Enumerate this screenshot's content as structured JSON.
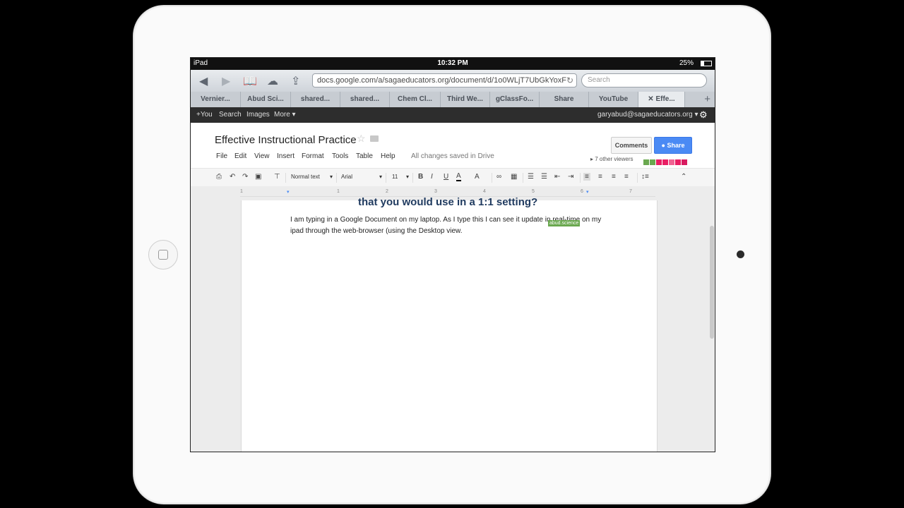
{
  "status": {
    "device": "iPad",
    "time": "10:32 PM",
    "battery": "25%"
  },
  "browser": {
    "url": "docs.google.com/a/sagaeducators.org/document/d/1o0WLjT7UbGkYoxF",
    "search_placeholder": "Search"
  },
  "tabs": [
    "Vernier...",
    "Abud Sci...",
    "shared...",
    "shared...",
    "Chem Cl...",
    "Third We...",
    "gClassFo...",
    "Share",
    "YouTube",
    "Effe..."
  ],
  "gbar": {
    "you": "+You",
    "search": "Search",
    "images": "Images",
    "more": "More ▾",
    "account": "garyabud@sagaeducators.org ▾"
  },
  "doc": {
    "title": "Effective Instructional Practice",
    "menu": [
      "File",
      "Edit",
      "View",
      "Insert",
      "Format",
      "Tools",
      "Table",
      "Help"
    ],
    "saved_status": "All changes saved in Drive",
    "comments_label": "Comments",
    "share_label": "Share",
    "viewers": "7 other viewers",
    "viewer_colors": [
      "#6aa84f",
      "#6aa84f",
      "#e91e63",
      "#e91e63",
      "#f06292",
      "#e91e63",
      "#d81b60"
    ]
  },
  "format": {
    "style": "Normal text",
    "font": "Arial",
    "size": "11"
  },
  "ruler": [
    "1",
    "1",
    "2",
    "3",
    "4",
    "5",
    "6",
    "7"
  ],
  "content": {
    "heading": "that you would use in a 1:1 setting?",
    "paragraph": "I am typing in a Google Document on my laptop. As I type this I can see it update in real-time on my ipad through the web-browser (using the Desktop view.",
    "collaborator": "abud.science"
  }
}
